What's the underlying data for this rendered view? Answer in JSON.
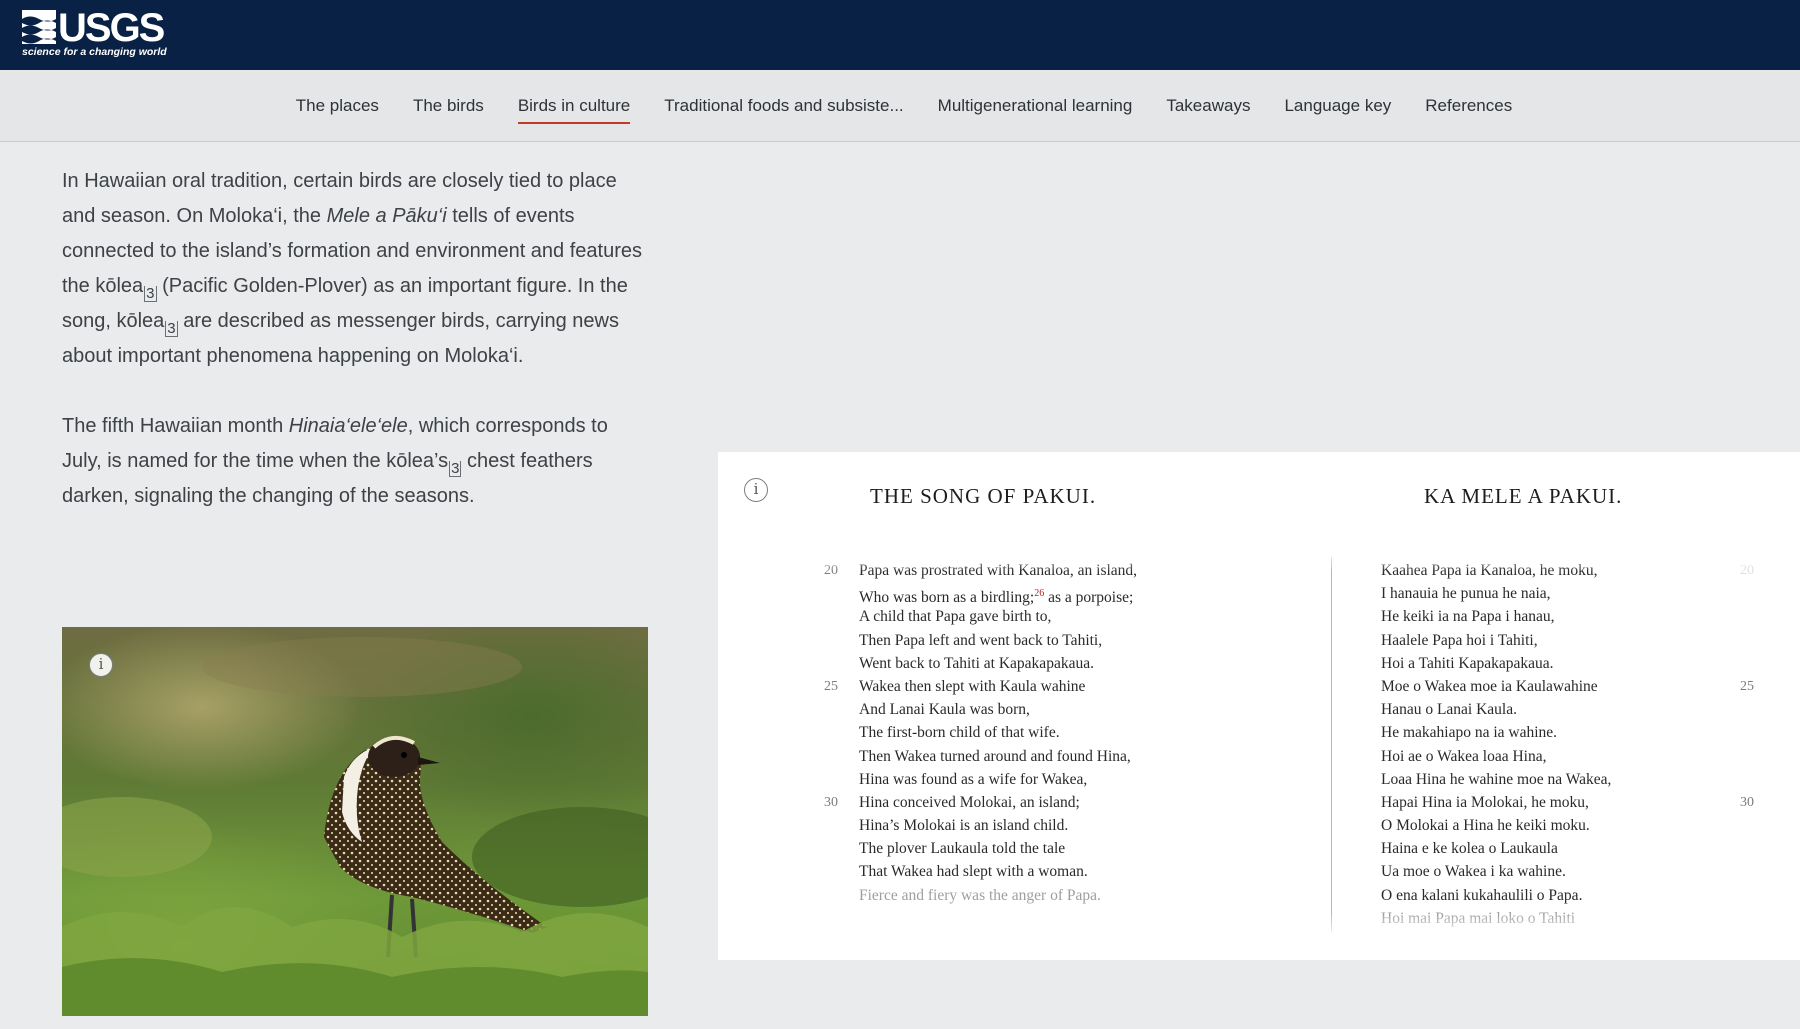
{
  "header": {
    "logo_text": "USGS",
    "logo_tagline": "science for a changing world",
    "logo_icon": "usgs-wave-mark"
  },
  "nav": {
    "items": [
      {
        "label": "The places",
        "active": false
      },
      {
        "label": "The birds",
        "active": false
      },
      {
        "label": "Birds in culture",
        "active": true
      },
      {
        "label": "Traditional foods and subsiste...",
        "active": false
      },
      {
        "label": "Multigenerational learning",
        "active": false
      },
      {
        "label": "Takeaways",
        "active": false
      },
      {
        "label": "Language key",
        "active": false
      },
      {
        "label": "References",
        "active": false
      }
    ],
    "active_underline_color": "#c0392b"
  },
  "content": {
    "p1": {
      "a": "In Hawaiian oral tradition, certain birds are closely tied to place and season. On Moloka‘i, the ",
      "b_italic": "Mele a Pāku‘i",
      "c": " tells of events connected to the island’s formation and environment and features the kōlea",
      "ref1": "3",
      "d": " (Pacific Golden-Plover) as an important figure. In the song, kōlea",
      "ref2": "3",
      "e": " are described as messenger birds, carrying news about important phenomena happening on Moloka‘i."
    },
    "p2": {
      "a": "The fifth Hawaiian month ",
      "b_italic": "Hinaia‘ele‘ele",
      "c": ", which corresponds to July, is named for the time when the kōlea’s",
      "ref1": "3",
      "d": " chest feathers darken, signaling the changing of the seasons."
    }
  },
  "photo": {
    "info_icon_label": "i",
    "subject": "plover-standing-in-vegetation"
  },
  "scan": {
    "info_icon_label": "i",
    "title_en": "THE SONG OF PAKUI.",
    "title_haw": "KA MELE A PAKUI.",
    "lines_en": [
      "Papa was prostrated with Kanaloa, an island,",
      "Who was born as a birdling;",
      "A child that Papa gave birth to,",
      "Then Papa left and went back to Tahiti,",
      "Went back to Tahiti at Kapakapakaua.",
      "Wakea then slept with Kaula wahine",
      "And Lanai Kaula was born,",
      "The first-born child of that wife.",
      "Then Wakea turned around and found Hina,",
      "Hina was found as a wife for Wakea,",
      "Hina conceived Molokai, an island;",
      "Hina’s Molokai is an island child.",
      "The plover Laukaula told the tale",
      "That Wakea had slept with a woman.",
      "Fierce and fiery was the anger of Papa."
    ],
    "footnote_26": "26",
    "line2_suffix": " as a porpoise;",
    "lines_haw": [
      "Kaahea Papa ia Kanaloa, he moku,",
      "I hanauia he punua he naia,",
      "He keiki ia na Papa i hanau,",
      "Haalele Papa hoi i Tahiti,",
      "Hoi a Tahiti Kapakapakaua.",
      "Moe o Wakea moe ia Kaulawahine",
      "Hanau o Lanai Kaula.",
      "He makahiapo na ia wahine.",
      "Hoi ae o Wakea loaa Hina,",
      "Loaa Hina he wahine moe na Wakea,",
      "Hapai Hina ia Molokai, he moku,",
      "O Molokai a Hina he keiki moku.",
      "Haina e ke kolea o Laukaula",
      "Ua moe o Wakea i ka wahine.",
      "O ena kalani kukahaulili o Papa.",
      "Hoi mai Papa mai loko o Tahiti"
    ],
    "line_numbers_en": {
      "l20": "20",
      "l25": "25",
      "l30": "30"
    },
    "line_numbers_haw": {
      "l20": "20",
      "l25": "25",
      "l30": "30"
    }
  }
}
